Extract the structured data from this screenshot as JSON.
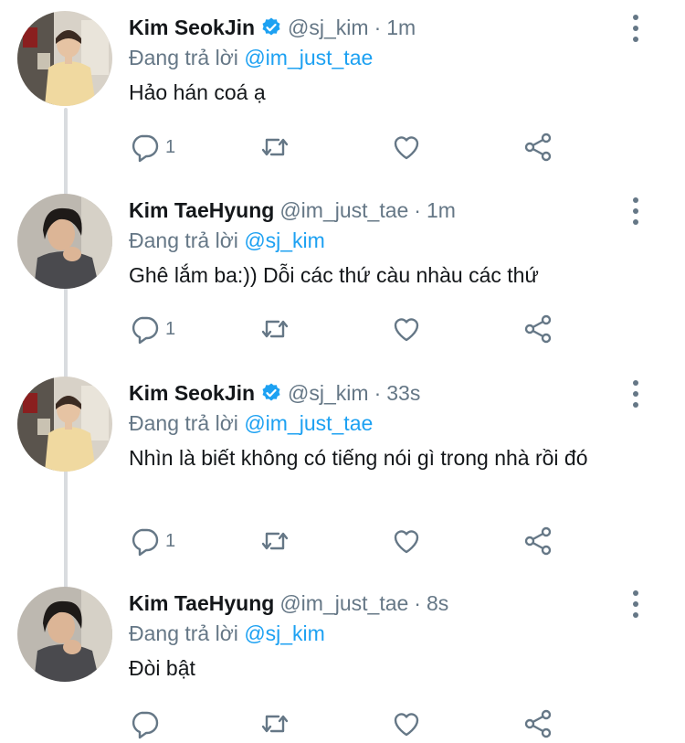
{
  "tweets": [
    {
      "name": "Kim SeokJin",
      "verified": true,
      "handle": "@sj_kim",
      "dot": "·",
      "time": "1m",
      "replying_prefix": "Đang trả lời",
      "replying_to": "@im_just_tae",
      "text": "Hảo hán coá ạ",
      "reply_count": "1",
      "avatar": "seokjin"
    },
    {
      "name": "Kim TaeHyung",
      "verified": false,
      "handle": "@im_just_tae",
      "dot": "·",
      "time": "1m",
      "replying_prefix": "Đang trả lời",
      "replying_to": "@sj_kim",
      "text": "Ghê lắm ba:)) Dỗi các thứ càu nhàu các thứ",
      "reply_count": "1",
      "avatar": "taehyung"
    },
    {
      "name": "Kim SeokJin",
      "verified": true,
      "handle": "@sj_kim",
      "dot": "·",
      "time": "33s",
      "replying_prefix": "Đang trả lời",
      "replying_to": "@im_just_tae",
      "text": "Nhìn là biết không có tiếng nói gì trong nhà rồi đó",
      "reply_count": "1",
      "avatar": "seokjin"
    },
    {
      "name": "Kim TaeHyung",
      "verified": false,
      "handle": "@im_just_tae",
      "dot": "·",
      "time": "8s",
      "replying_prefix": "Đang trả lời",
      "replying_to": "@sj_kim",
      "text": "Đòi bật",
      "reply_count": "",
      "avatar": "taehyung"
    }
  ],
  "icons": {
    "reply": "reply-icon",
    "retweet": "retweet-icon",
    "like": "heart-icon",
    "share": "share-icon",
    "more": "more-vertical-icon",
    "verified": "verified-badge-icon"
  },
  "colors": {
    "accent": "#1da1f2",
    "secondary_text": "#657786",
    "icon": "#657786",
    "thread_line": "#d9dcdf"
  }
}
